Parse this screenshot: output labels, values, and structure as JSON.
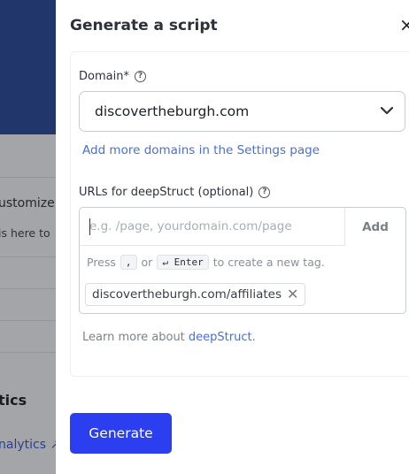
{
  "background": {
    "text_customize": "ustomize",
    "text_here": "is here to",
    "section_heading": "tics",
    "analytics_link": "nalytics ↗"
  },
  "drawer": {
    "title": "Generate a script",
    "close_icon": "×",
    "domain": {
      "label": "Domain*",
      "selected": "discovertheburgh.com",
      "settings_link": "Add more domains in the Settings page"
    },
    "urls": {
      "label": "URLs for deepStruct (optional)",
      "placeholder": "e.g. /page, yourdomain.com/page",
      "add_label": "Add",
      "hint_press": "Press",
      "hint_key_comma": ",",
      "hint_or": "or",
      "hint_key_enter": "↵ Enter",
      "hint_suffix": "to create a new tag.",
      "tags": [
        "discovertheburgh.com/affiliates"
      ]
    },
    "learn": {
      "prefix": "Learn more about ",
      "link": "deepStruct",
      "suffix": "."
    },
    "generate_label": "Generate"
  },
  "colors": {
    "primary_button": "#2b3ff0",
    "link": "#4a6fd0",
    "bg_header": "#2c4d9c"
  }
}
